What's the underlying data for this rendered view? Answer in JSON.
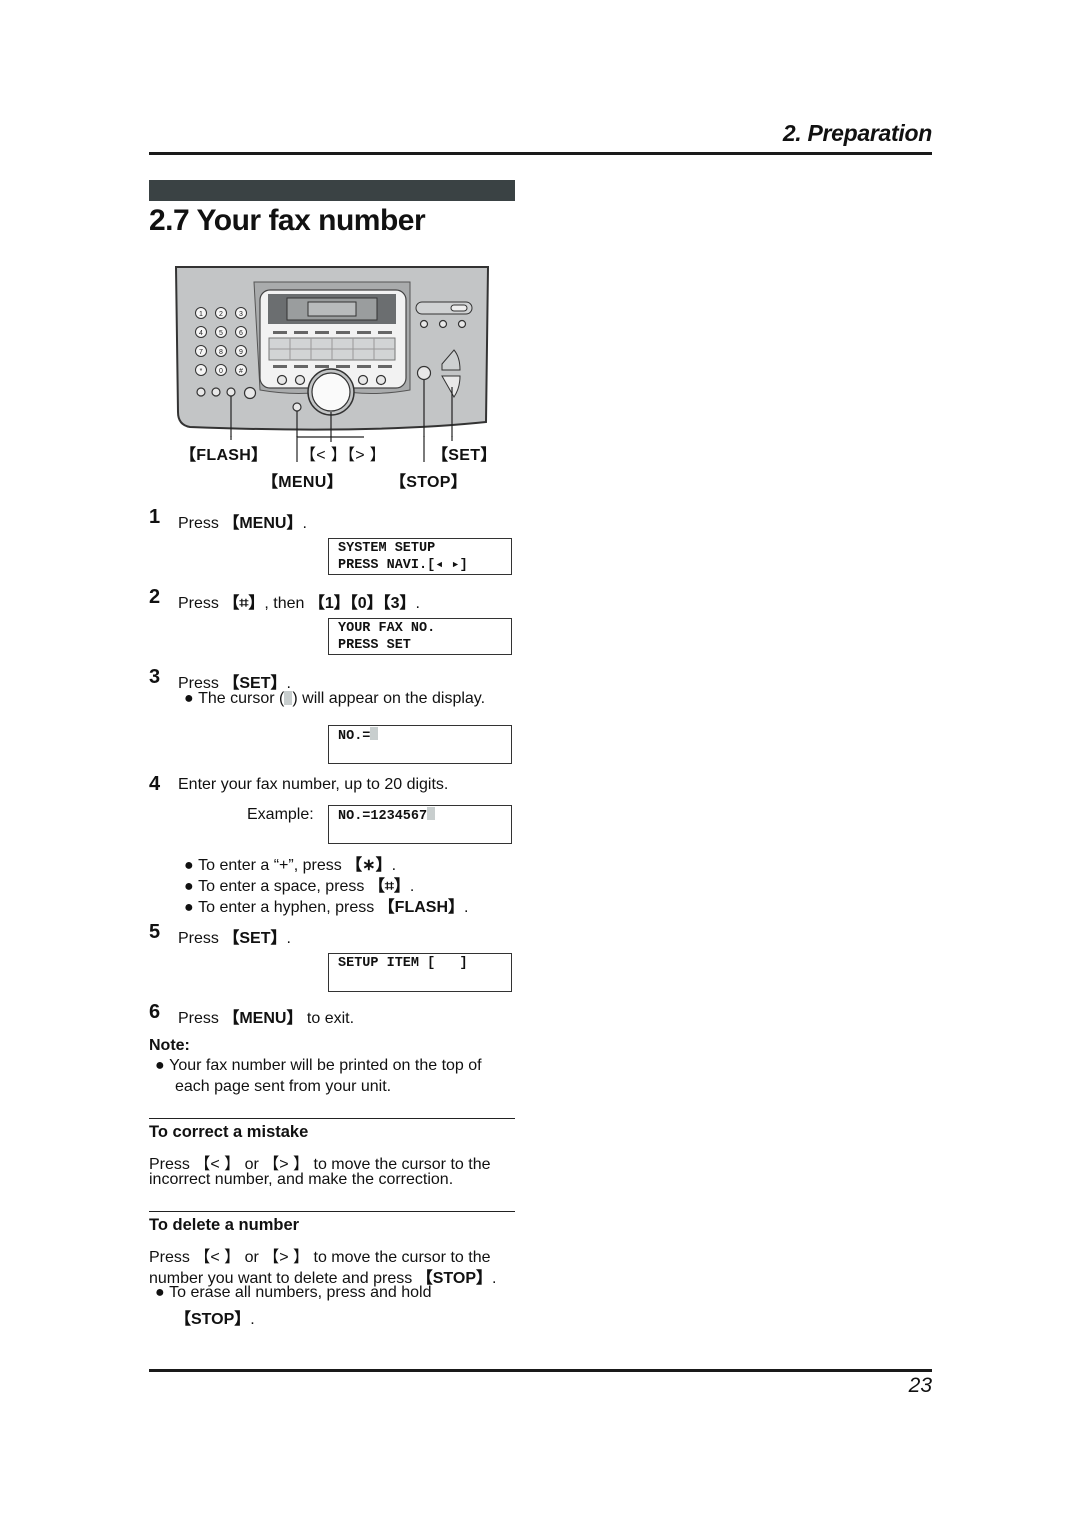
{
  "header": {
    "chapter": "2. Preparation"
  },
  "section": {
    "title": "2.7 Your fax number"
  },
  "device": {
    "keypad": [
      "1",
      "2",
      "3",
      "4",
      "5",
      "6",
      "7",
      "8",
      "9",
      "*",
      "0",
      "#"
    ],
    "labels": {
      "flash": "【FLASH】",
      "nav": "【< 】【> 】",
      "set": "【SET】",
      "menu": "【MENU】",
      "stop": "【STOP】"
    }
  },
  "steps": [
    {
      "num": "1",
      "pre": "Press ",
      "key": "【MENU】",
      "post": ".",
      "lcd": [
        "SYSTEM SETUP",
        "PRESS NAVI.[◂ ▸]"
      ]
    },
    {
      "num": "2",
      "pre": "Press ",
      "key": "【⌗】",
      "mid": ", then ",
      "key2": "【1】【0】【3】",
      "post": ".",
      "lcd": [
        "YOUR FAX NO.",
        "PRESS SET"
      ]
    },
    {
      "num": "3",
      "pre": "Press ",
      "key": "【SET】",
      "post": ".",
      "bullet_pre": "The cursor (",
      "bullet_post": ") will appear on the display.",
      "lcd": [
        "NO.="
      ]
    },
    {
      "num": "4",
      "text": "Enter your fax number, up to 20 digits.",
      "example_label": "Example:",
      "lcd": [
        "NO.=1234567"
      ],
      "bullets": [
        {
          "pre": "To enter a “+”, press ",
          "key": "【∗】",
          "post": "."
        },
        {
          "pre": "To enter a space, press ",
          "key": "【⌗】",
          "post": "."
        },
        {
          "pre": "To enter a hyphen, press ",
          "key": "【FLASH】",
          "post": "."
        }
      ]
    },
    {
      "num": "5",
      "pre": "Press ",
      "key": "【SET】",
      "post": ".",
      "lcd": [
        "SETUP ITEM [   ]"
      ]
    },
    {
      "num": "6",
      "pre": "Press ",
      "key": "【MENU】",
      "post": " to exit."
    }
  ],
  "note": {
    "label": "Note:",
    "line1": "Your fax number will be printed on the top of",
    "line2": "each page sent from your unit."
  },
  "correct": {
    "title": "To correct a mistake",
    "p1": "Press ",
    "k1": "【< 】",
    "p2": " or ",
    "k2": "【> 】",
    "p3": " to move the cursor to the",
    "line2": "incorrect number, and make the correction."
  },
  "delete": {
    "title": "To delete a number",
    "p1": "Press ",
    "k1": "【< 】",
    "p2": " or ",
    "k2": "【> 】",
    "p3": " to move the cursor to the",
    "line2_pre": "number you want to delete and press ",
    "line2_key": "【STOP】",
    "line2_post": ".",
    "bullet_line1": "To erase all numbers, press and hold",
    "bullet_key": "【STOP】",
    "bullet_post": "."
  },
  "footer": {
    "page": "23"
  }
}
